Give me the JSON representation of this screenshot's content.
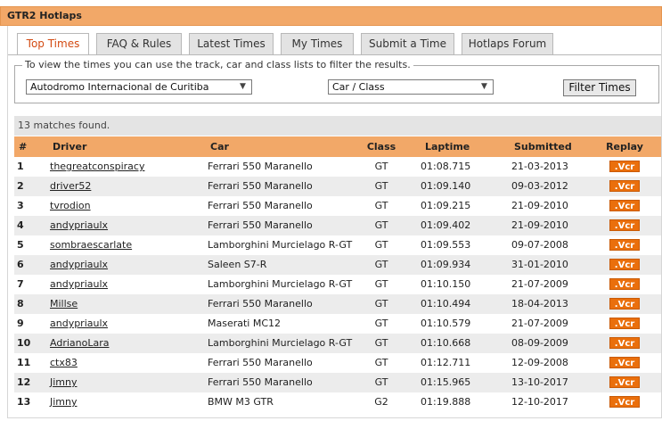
{
  "header": {
    "title": "GTR2 Hotlaps"
  },
  "tabs": [
    {
      "label": "Top Times",
      "active": true
    },
    {
      "label": "FAQ & Rules",
      "active": false
    },
    {
      "label": "Latest Times",
      "active": false
    },
    {
      "label": "My Times",
      "active": false
    },
    {
      "label": "Submit a Time",
      "active": false
    },
    {
      "label": "Hotlaps Forum",
      "active": false
    }
  ],
  "filter": {
    "legend": "To view the times you can use the track, car and class lists to filter the results.",
    "track": "Autodromo Internacional de Curitiba",
    "car_class": "Car / Class",
    "button": "Filter Times"
  },
  "results": {
    "summary": "13 matches found.",
    "columns": {
      "num": "#",
      "driver": "Driver",
      "car": "Car",
      "class": "Class",
      "laptime": "Laptime",
      "submitted": "Submitted",
      "replay": "Replay"
    },
    "replay_label": ".Vcr",
    "rows": [
      {
        "num": "1",
        "driver": "thegreatconspiracy",
        "car": "Ferrari 550 Maranello",
        "class": "GT",
        "laptime": "01:08.715",
        "submitted": "21-03-2013"
      },
      {
        "num": "2",
        "driver": "driver52",
        "car": "Ferrari 550 Maranello",
        "class": "GT",
        "laptime": "01:09.140",
        "submitted": "09-03-2012"
      },
      {
        "num": "3",
        "driver": "tvrodion",
        "car": "Ferrari 550 Maranello",
        "class": "GT",
        "laptime": "01:09.215",
        "submitted": "21-09-2010"
      },
      {
        "num": "4",
        "driver": "andypriaulx",
        "car": "Ferrari 550 Maranello",
        "class": "GT",
        "laptime": "01:09.402",
        "submitted": "21-09-2010"
      },
      {
        "num": "5",
        "driver": "sombraescarlate",
        "car": "Lamborghini Murcielago R-GT",
        "class": "GT",
        "laptime": "01:09.553",
        "submitted": "09-07-2008"
      },
      {
        "num": "6",
        "driver": "andypriaulx",
        "car": "Saleen S7-R",
        "class": "GT",
        "laptime": "01:09.934",
        "submitted": "31-01-2010"
      },
      {
        "num": "7",
        "driver": "andypriaulx",
        "car": "Lamborghini Murcielago R-GT",
        "class": "GT",
        "laptime": "01:10.150",
        "submitted": "21-07-2009"
      },
      {
        "num": "8",
        "driver": "Millse",
        "car": "Ferrari 550 Maranello",
        "class": "GT",
        "laptime": "01:10.494",
        "submitted": "18-04-2013"
      },
      {
        "num": "9",
        "driver": "andypriaulx",
        "car": "Maserati MC12",
        "class": "GT",
        "laptime": "01:10.579",
        "submitted": "21-07-2009"
      },
      {
        "num": "10",
        "driver": "AdrianoLara",
        "car": "Lamborghini Murcielago R-GT",
        "class": "GT",
        "laptime": "01:10.668",
        "submitted": "08-09-2009"
      },
      {
        "num": "11",
        "driver": "ctx83",
        "car": "Ferrari 550 Maranello",
        "class": "GT",
        "laptime": "01:12.711",
        "submitted": "12-09-2008"
      },
      {
        "num": "12",
        "driver": "Jimny",
        "car": "Ferrari 550 Maranello",
        "class": "GT",
        "laptime": "01:15.965",
        "submitted": "13-10-2017"
      },
      {
        "num": "13",
        "driver": "Jimny",
        "car": "BMW M3 GTR",
        "class": "G2",
        "laptime": "01:19.888",
        "submitted": "12-10-2017"
      }
    ]
  },
  "colors": {
    "accent": "#f2a868",
    "active_tab_text": "#d34a12",
    "vcr_button": "#ea6f0c",
    "row_alt": "#ececec"
  }
}
